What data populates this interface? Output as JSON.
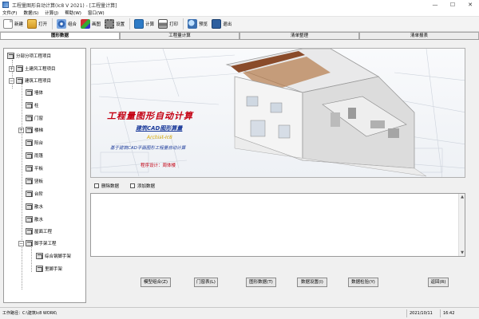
{
  "window": {
    "title": "工程量图形自动计算(Ic8 V 2021) - [工程量计算]",
    "minimize_glyph": "—",
    "maximize_glyph": "☐",
    "close_glyph": "✕"
  },
  "menu": [
    "文件(F)",
    "数据(S)",
    "计算(J)",
    "帮助(W)",
    "窗口(W)"
  ],
  "toolbar": {
    "new": "新建",
    "open": "打开",
    "combine": "组合",
    "draw": "画图",
    "settings": "设置",
    "calc": "计算",
    "print": "打印",
    "preview": "预览",
    "exit": "退出"
  },
  "tabs": [
    {
      "label": "图形数据",
      "active": true
    },
    {
      "label": "工程量计算",
      "active": false
    },
    {
      "label": "清单整理",
      "active": false
    },
    {
      "label": "清单报表",
      "active": false
    }
  ],
  "tree": {
    "root": "分部分项工程项目",
    "items": [
      "土建风工程项目",
      "建筑工程项目",
      "墙体",
      "柱",
      "门窗",
      "楼梯",
      "阳台",
      "雨篷",
      "平板",
      "竖板",
      "台阶",
      "散水",
      "散水",
      "屋面工程",
      "脚手架工程",
      "综合钢脚手架",
      "里脚手架"
    ]
  },
  "banner": {
    "title": "工程量图形自动计算",
    "subtitle": "建筑CAD图形算量",
    "company": "Archist-Ic8",
    "tagline": "基于建筑CAD平面图形工程量自动计算",
    "author": "程序设计：周体楼"
  },
  "checkboxes": [
    "删除数据",
    "添加数据"
  ],
  "buttons": {
    "template": "模型组合(Z)",
    "doors": "门窗表(L)",
    "graphics": "图形数据(T)",
    "data_settings": "数据设置(I)",
    "data_check": "数据检验(Y)",
    "back": "返回(R)"
  },
  "status": {
    "work_path": "工作路径：C:\\建筑Ic8 WORK\\",
    "date": "2021/10/11",
    "time": "16:42"
  }
}
